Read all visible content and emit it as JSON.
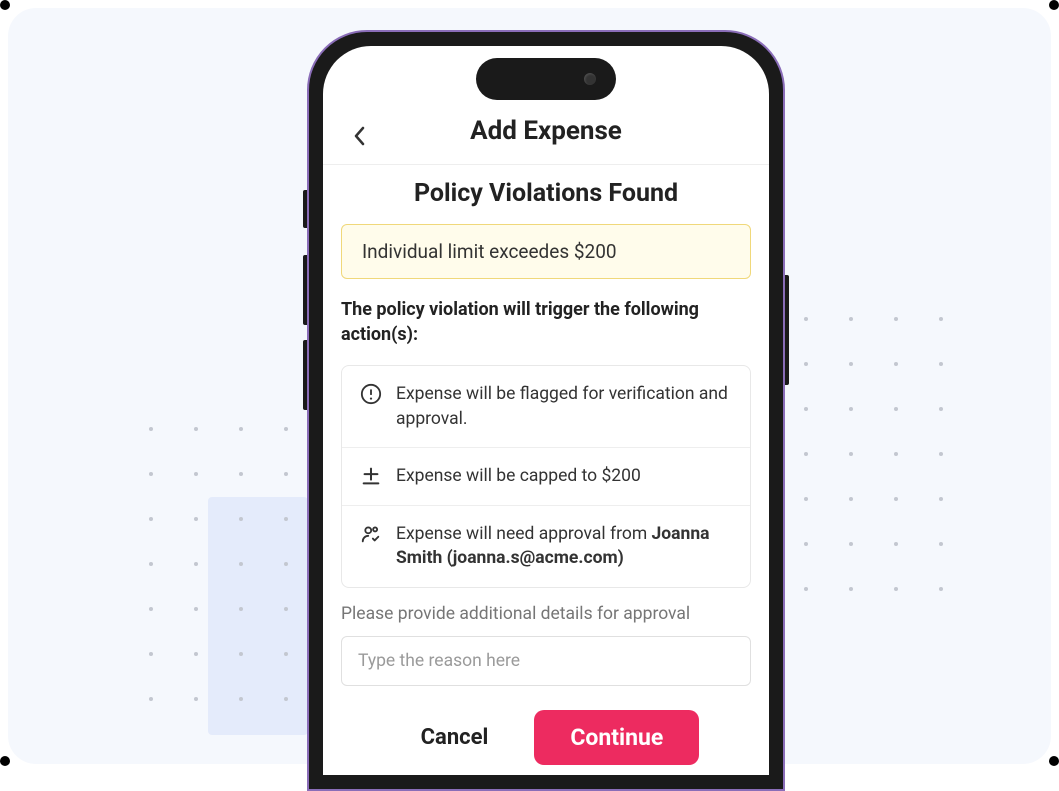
{
  "header": {
    "title": "Add Expense"
  },
  "panel": {
    "title": "Policy Violations Found",
    "violation_message": "Individual limit exceedes $200",
    "trigger_label": "The policy violation will trigger the following action(s):",
    "actions": [
      {
        "icon": "alert-circle-icon",
        "text": "Expense will be flagged for verification and approval."
      },
      {
        "icon": "cap-icon",
        "text": "Expense will be capped to $200"
      },
      {
        "icon": "people-approve-icon",
        "text_prefix": "Expense will need approval from ",
        "text_bold": "Joanna Smith (joanna.s@acme.com)"
      }
    ],
    "details_label": "Please provide additional details for approval",
    "reason_placeholder": "Type the reason here"
  },
  "buttons": {
    "cancel": "Cancel",
    "continue": "Continue"
  },
  "colors": {
    "accent": "#ed2b60",
    "violation_bg": "#fffceb",
    "violation_border": "#f0d87a"
  }
}
